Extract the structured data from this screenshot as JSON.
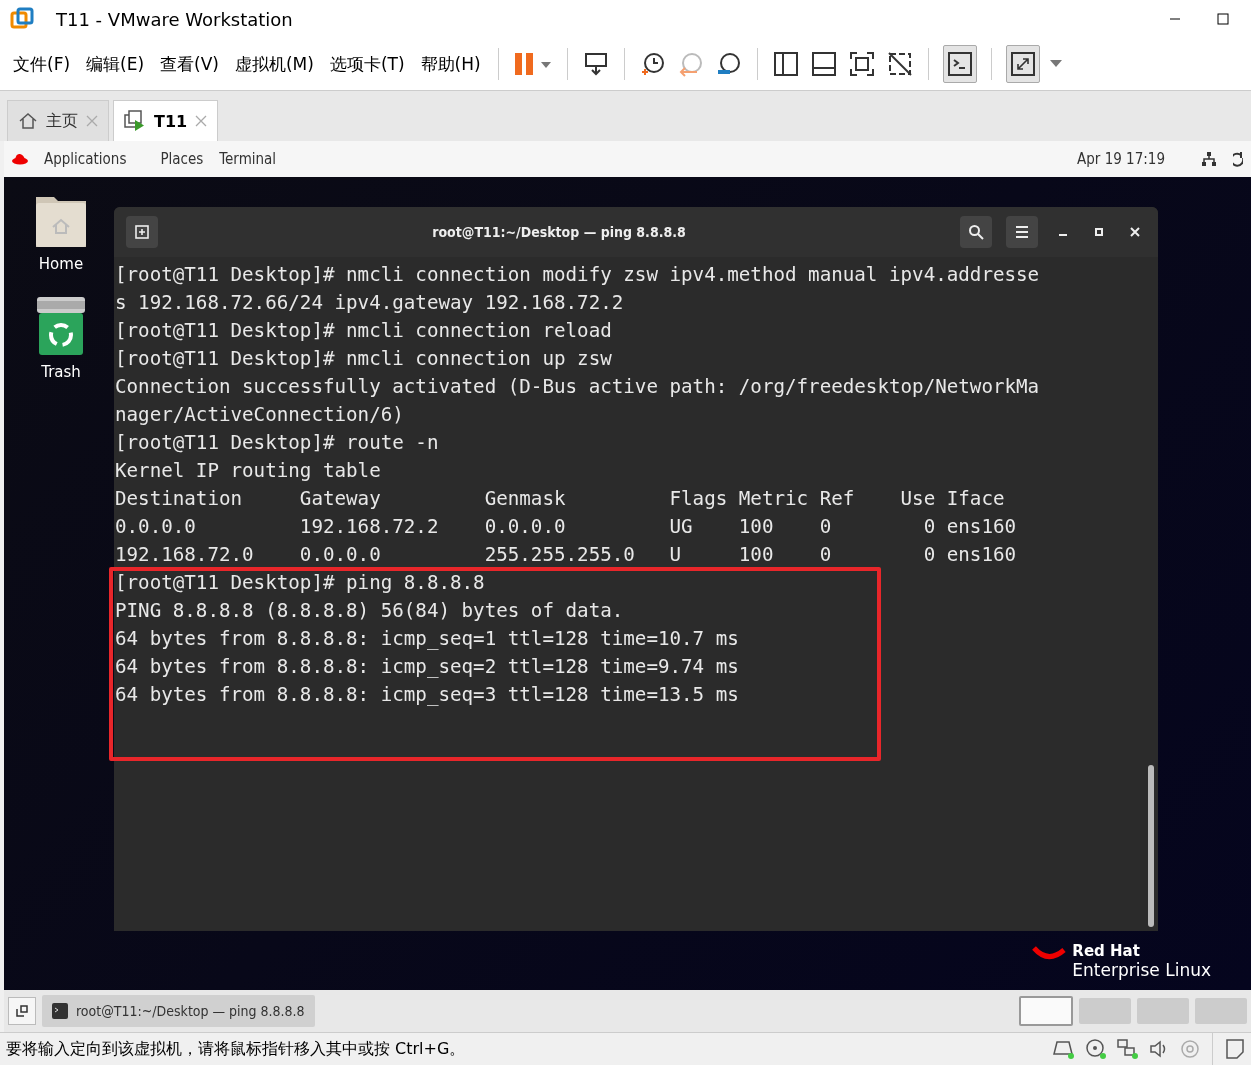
{
  "window": {
    "title": "T11 - VMware Workstation"
  },
  "menu": [
    "文件(F)",
    "编辑(E)",
    "查看(V)",
    "虚拟机(M)",
    "选项卡(T)",
    "帮助(H)"
  ],
  "tabs": [
    {
      "label": "主页",
      "selected": false,
      "kind": "home"
    },
    {
      "label": "T11",
      "selected": true,
      "kind": "vm"
    }
  ],
  "gnome_bar": {
    "items": [
      "Applications",
      "Places",
      "Terminal"
    ],
    "clock": "Apr 19  17:19"
  },
  "desktop_icons": [
    {
      "label": "Home",
      "kind": "folder"
    },
    {
      "label": "Trash",
      "kind": "trash"
    }
  ],
  "terminal": {
    "title": "root@T11:~/Desktop — ping 8.8.8.8",
    "lines": [
      "[root@T11 Desktop]# nmcli connection modify zsw ipv4.method manual ipv4.addresse",
      "s 192.168.72.66/24 ipv4.gateway 192.168.72.2",
      "[root@T11 Desktop]# nmcli connection reload",
      "[root@T11 Desktop]# nmcli connection up zsw",
      "Connection successfully activated (D-Bus active path: /org/freedesktop/NetworkMa",
      "nager/ActiveConnection/6)",
      "[root@T11 Desktop]# route -n",
      "Kernel IP routing table",
      "Destination     Gateway         Genmask         Flags Metric Ref    Use Iface",
      "0.0.0.0         192.168.72.2    0.0.0.0         UG    100    0        0 ens160",
      "192.168.72.0    0.0.0.0         255.255.255.0   U     100    0        0 ens160",
      "[root@T11 Desktop]# ping 8.8.8.8",
      "PING 8.8.8.8 (8.8.8.8) 56(84) bytes of data.",
      "64 bytes from 8.8.8.8: icmp_seq=1 ttl=128 time=10.7 ms",
      "64 bytes from 8.8.8.8: icmp_seq=2 ttl=128 time=9.74 ms",
      "64 bytes from 8.8.8.8: icmp_seq=3 ttl=128 time=13.5 ms"
    ]
  },
  "brand": [
    "Red Hat",
    "Enterprise Linux"
  ],
  "taskbar": {
    "item": "root@T11:~/Desktop — ping 8.8.8.8",
    "workspaces": [
      {
        "selected": true
      },
      {
        "selected": false
      },
      {
        "selected": false
      },
      {
        "selected": false
      }
    ]
  },
  "status_bar": {
    "message": "要将输入定向到该虚拟机，请将鼠标指针移入其中或按 Ctrl+G。"
  }
}
